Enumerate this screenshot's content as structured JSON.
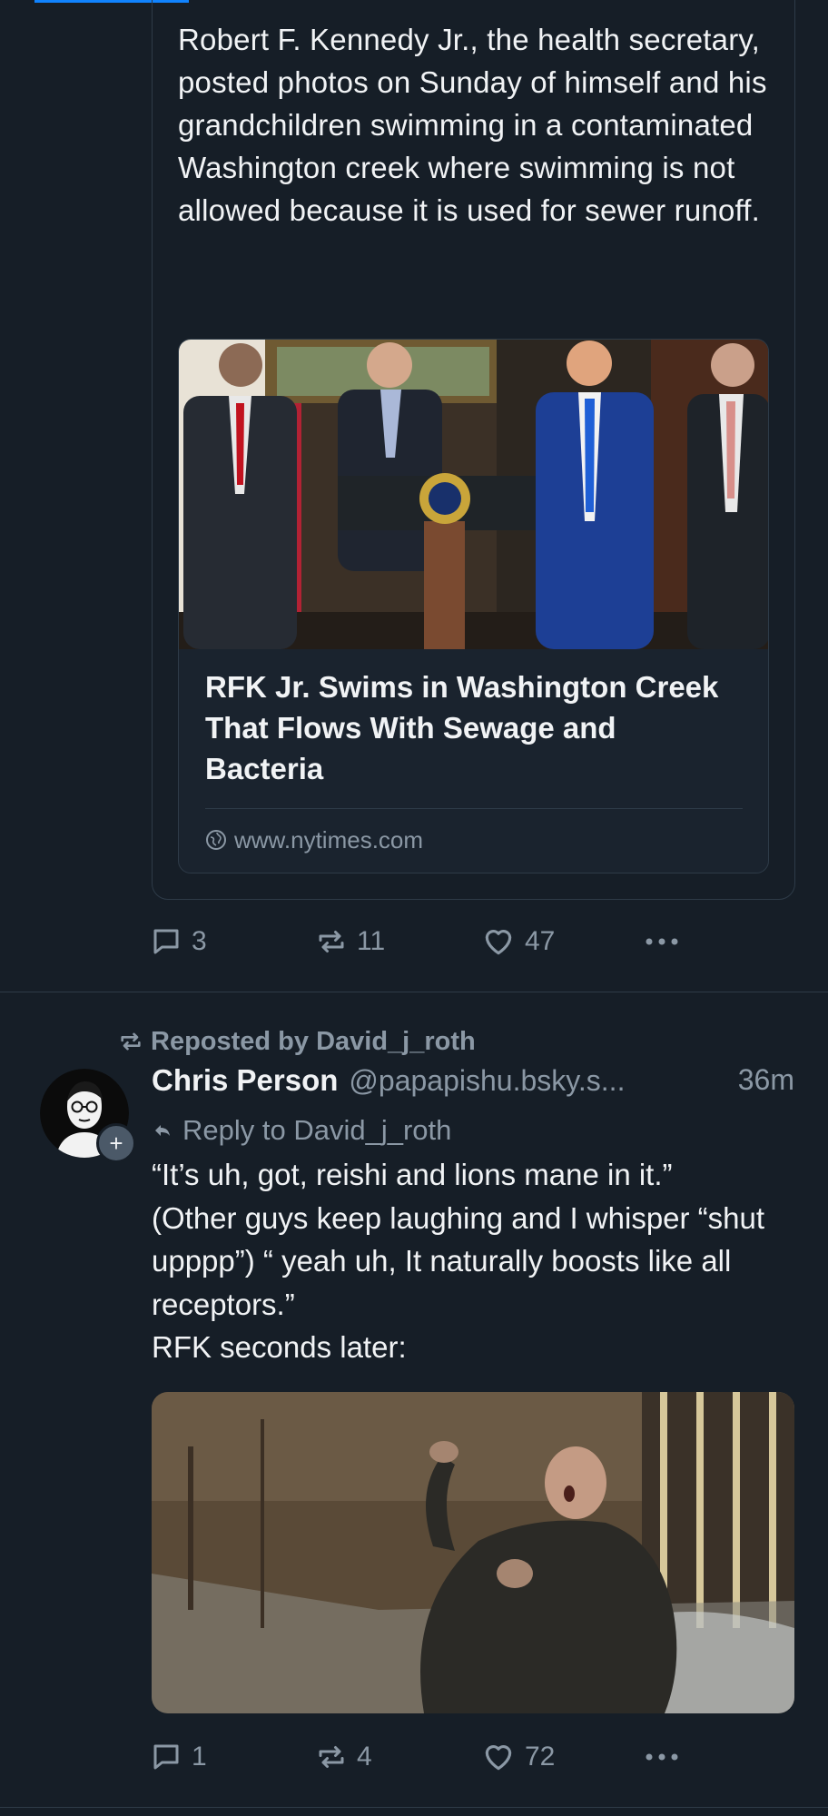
{
  "colors": {
    "background": "#161e27",
    "accent": "#1083fe",
    "muted": "#8b98a5",
    "border": "#2e3b48"
  },
  "quoted_post": {
    "text": "Robert F. Kennedy Jr., the health secretary, posted photos on Sunday of himself and his grandchildren swimming in a contaminated Washington creek where swimming is not allowed because it is used for sewer runoff.",
    "link_card": {
      "title": "RFK Jr. Swims in Washington Creek That Flows With Sewage and Bacteria",
      "domain": "www.nytimes.com",
      "icon": "globe-icon"
    },
    "actions": {
      "replies": "3",
      "reposts": "11",
      "likes": "47"
    }
  },
  "post": {
    "repost_label": "Reposted by David_j_roth",
    "author_name": "Chris Person",
    "author_handle": "@papapishu.bsky.s...",
    "time": "36m",
    "reply_to": "Reply to David_j_roth",
    "text": "“It’s uh, got, reishi and lions mane in it.”\n(Other guys keep laughing and I whisper “shut upppp”) “ yeah uh, It naturally boosts like all receptors.”\nRFK seconds later:",
    "avatar_badge": "+",
    "actions": {
      "replies": "1",
      "reposts": "4",
      "likes": "72"
    }
  },
  "icons": {
    "reply": "speech-bubble-icon",
    "repost": "repost-arrows-icon",
    "like": "heart-icon",
    "more": "more-dots-icon"
  }
}
